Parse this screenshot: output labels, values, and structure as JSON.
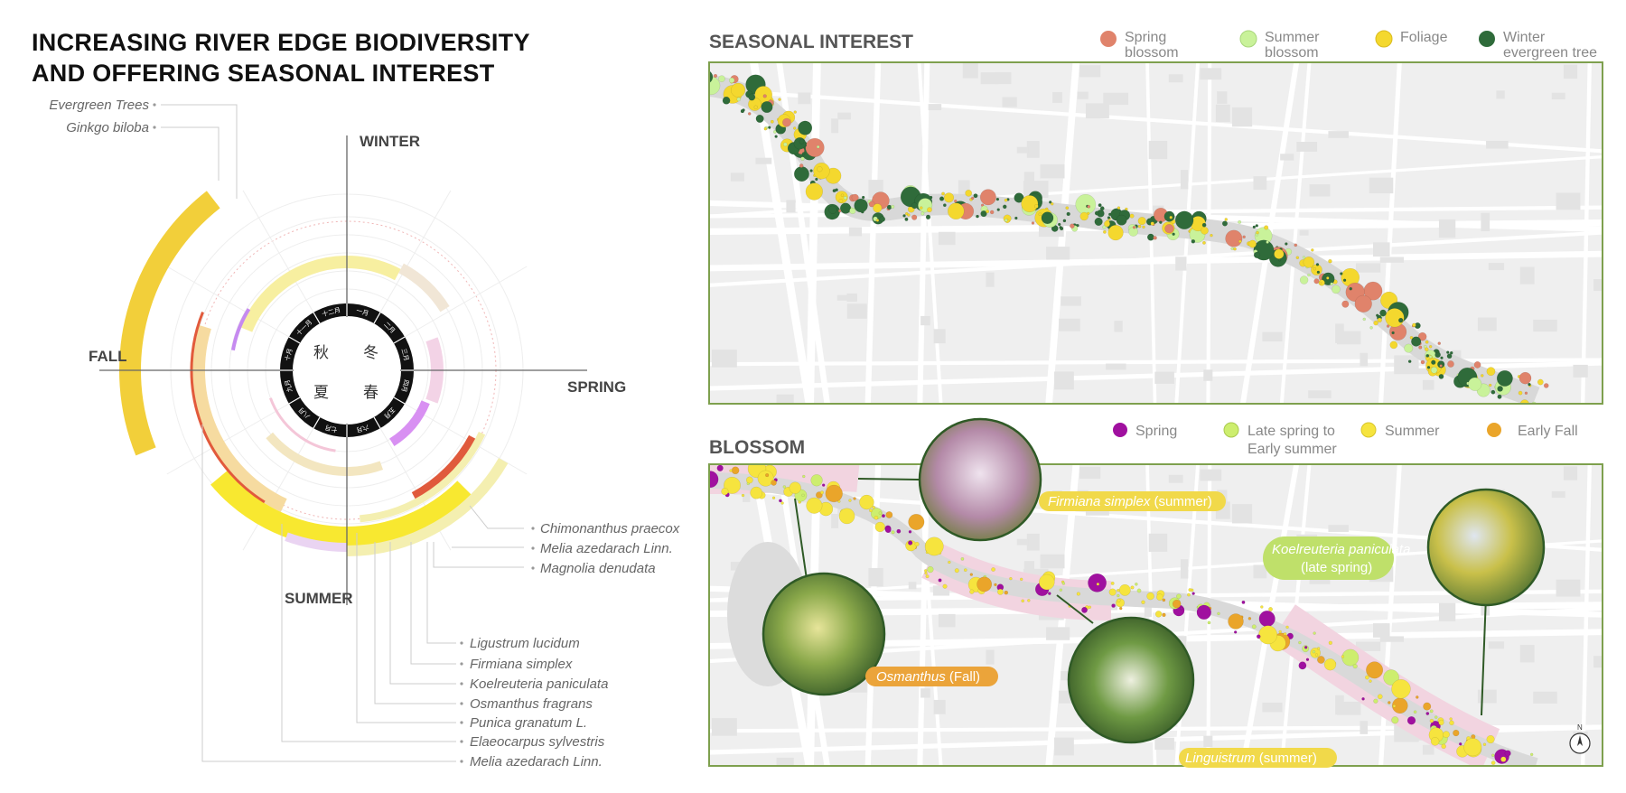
{
  "title": {
    "line1": "INCREASING RIVER EDGE BIODIVERSITY",
    "line2": "AND OFFERING SEASONAL INTEREST"
  },
  "wheel": {
    "seasons": {
      "winter": "WINTER",
      "spring": "SPRING",
      "summer": "SUMMER",
      "fall": "FALL"
    },
    "center_chars": {
      "fall": "秋",
      "winter": "冬",
      "summer": "夏",
      "spring": "春"
    },
    "months": [
      "一月",
      "二月",
      "三月",
      "四月",
      "五月",
      "六月",
      "七月",
      "八月",
      "九月",
      "十月",
      "十一月",
      "十二月"
    ],
    "labels_top_left": [
      "Evergreen Trees",
      "Ginkgo biloba"
    ],
    "labels_right": [
      "Chimonanthus praecox",
      "Melia azedarach Linn.",
      "Magnolia denudata"
    ],
    "labels_bottom": [
      "Ligustrum lucidum",
      "Firmiana simplex",
      "Koelreuteria paniculata",
      "Osmanthus fragrans",
      "Punica granatum L.",
      "Elaeocarpus sylvestris",
      "Melia azedarach Linn."
    ]
  },
  "seasonal_interest": {
    "heading": "SEASONAL INTEREST",
    "legend": [
      {
        "line1": "Spring",
        "line2": "blossom",
        "color": "#e0836b"
      },
      {
        "line1": "Summer",
        "line2": "blossom",
        "color": "#c9f29a"
      },
      {
        "line1": "Foliage",
        "line2": "",
        "color": "#f4d82e"
      },
      {
        "line1": "Winter",
        "line2": "evergreen tree",
        "color": "#2f6b3a"
      }
    ]
  },
  "blossom": {
    "heading": "BLOSSOM",
    "legend": [
      {
        "line1": "Spring",
        "line2": "",
        "color": "#a0109f"
      },
      {
        "line1": "Late spring to",
        "line2": "Early summer",
        "color": "#cdee6e"
      },
      {
        "line1": "Summer",
        "line2": "",
        "color": "#f6e43e"
      },
      {
        "line1": "Early Fall",
        "line2": "",
        "color": "#eaa52a"
      }
    ],
    "callouts": {
      "firmiana": {
        "name": "Firmiana simplex",
        "season": "(summer)"
      },
      "osmanthus": {
        "name": "Osmanthus",
        "season": "(Fall)"
      },
      "linguistrum": {
        "name": "Linguistrum",
        "season": "(summer)"
      },
      "koelreuteria": {
        "name": "Koelreuteria paniculata",
        "season": "(late spring)"
      }
    },
    "compass": "N"
  }
}
